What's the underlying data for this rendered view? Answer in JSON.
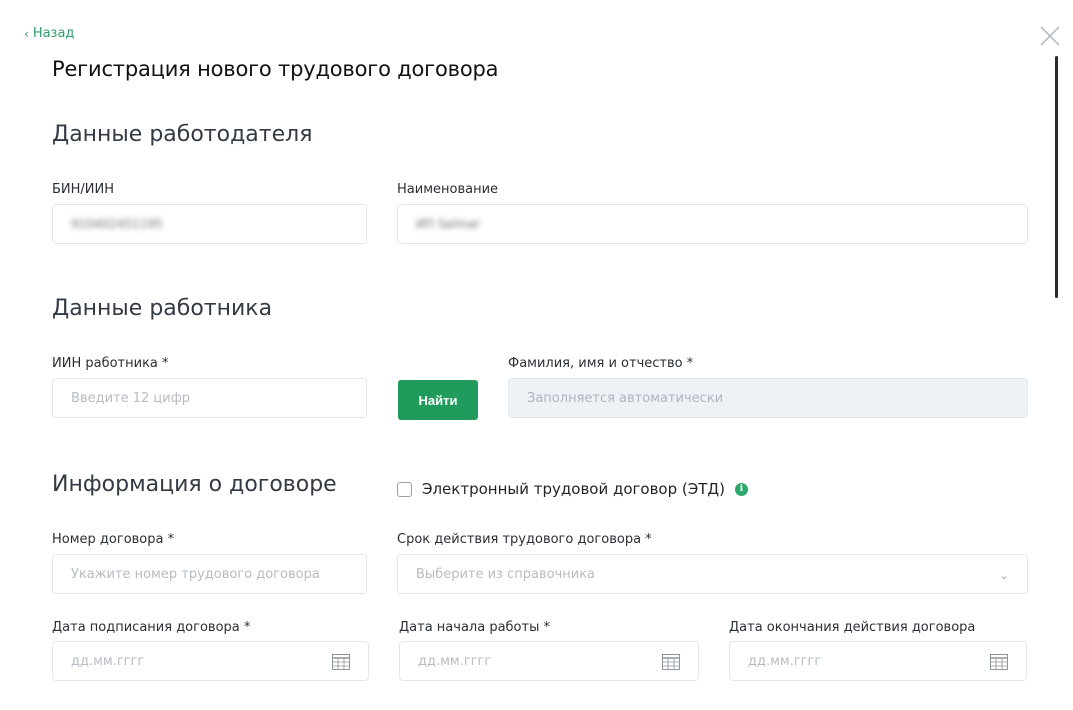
{
  "header": {
    "back_label": "Назад",
    "title": "Регистрация нового трудового договора"
  },
  "employer": {
    "section_title": "Данные работодателя",
    "bin_label": "БИН/ИИН",
    "bin_value": "910402451195",
    "name_label": "Наименование",
    "name_value": "ИП Salmar"
  },
  "employee": {
    "section_title": "Данные работника",
    "iin_label": "ИИН работника *",
    "iin_placeholder": "Введите 12 цифр",
    "find_label": "Найти",
    "fio_label": "Фамилия, имя и отчество *",
    "fio_placeholder": "Заполняется автоматически"
  },
  "contract": {
    "section_title": "Информация о договоре",
    "etd_label": "Электронный трудовой договор (ЭТД)",
    "etd_checked": false,
    "number_label": "Номер договора *",
    "number_placeholder": "Укажите номер трудового договора",
    "term_label": "Срок действия трудового договора *",
    "term_placeholder": "Выберите из справочника",
    "sign_date_label": "Дата подписания договора *",
    "start_date_label": "Дата начала работы *",
    "end_date_label": "Дата окончания действия договора",
    "date_placeholder": "дд.мм.гггг"
  },
  "colors": {
    "accent": "#1f9c5b",
    "link": "#2f9e6a",
    "readonly_bg": "#eef2f7",
    "border": "#e3e7ec"
  },
  "icons": {
    "back": "chevron-left-icon",
    "close": "close-icon",
    "calendar": "calendar-icon",
    "dropdown": "chevron-down-icon",
    "info": "info-icon"
  }
}
